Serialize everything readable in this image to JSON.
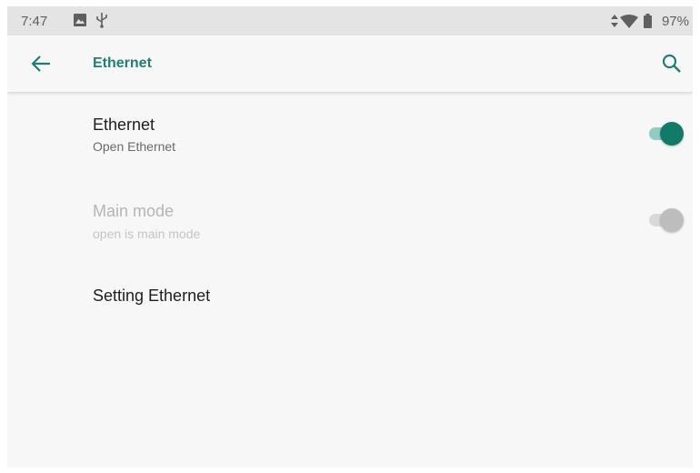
{
  "status_bar": {
    "time": "7:47",
    "icons": [
      "image-icon",
      "usb-icon",
      "data-arrows-icon",
      "wifi-icon",
      "battery-icon"
    ],
    "battery": "97%"
  },
  "app_bar": {
    "back_icon": "arrow-back-icon",
    "title": "Ethernet",
    "search_icon": "search-icon",
    "accent_color": "#1f7f73"
  },
  "settings": {
    "ethernet": {
      "title": "Ethernet",
      "subtitle": "Open Ethernet",
      "enabled": true,
      "switch_on": true
    },
    "main_mode": {
      "title": "Main mode",
      "subtitle": "open is main mode",
      "enabled": false,
      "switch_on": false
    },
    "setting_ethernet": {
      "title": "Setting Ethernet"
    }
  },
  "colors": {
    "switch_on_thumb": "#0f7b68",
    "switch_on_track": "#8fcdc2",
    "switch_disabled_thumb": "#bdbdbd",
    "switch_disabled_track": "#d9d9d9",
    "background": "#f7f7f7",
    "status_bar": "#e4e4e4"
  }
}
